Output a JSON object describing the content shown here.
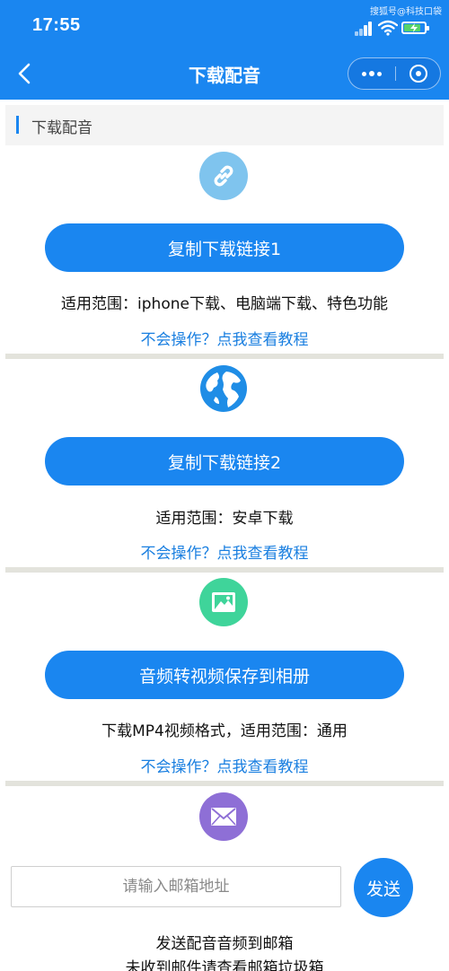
{
  "status_bar": {
    "time": "17:55",
    "watermark": "搜狐号@科技口袋",
    "signal_icon": "signal-icon",
    "wifi_icon": "wifi-icon",
    "battery_icon": "battery-charging-icon",
    "battery_color": "#56d36a"
  },
  "nav": {
    "title": "下载配音",
    "back_icon": "chevron-left-icon",
    "more_icon": "more-dots-icon",
    "close_icon": "circle-target-icon",
    "color": "#1a86f0"
  },
  "section": {
    "title": "下载配音"
  },
  "options": [
    {
      "icon": "link-icon",
      "icon_color": "#7fc4ee",
      "button_label": "复制下载链接1",
      "description": "适用范围：iphone下载、电脑端下载、特色功能",
      "help_text": "不会操作？点我查看教程"
    },
    {
      "icon": "globe-icon",
      "icon_color": "#1f8de6",
      "button_label": "复制下载链接2",
      "description": "适用范围：安卓下载",
      "help_text": "不会操作？点我查看教程"
    },
    {
      "icon": "image-icon",
      "icon_color": "#3fd49a",
      "button_label": "音频转视频保存到相册",
      "description": "下载MP4视频格式，适用范围：通用",
      "help_text": "不会操作？点我查看教程"
    }
  ],
  "email": {
    "icon": "envelope-icon",
    "icon_color": "#8e6fd6",
    "placeholder": "请输入邮箱地址",
    "value": "",
    "send_label": "发送",
    "description": "发送配音音频到邮箱",
    "note": "未收到邮件请查看邮箱垃圾箱"
  }
}
